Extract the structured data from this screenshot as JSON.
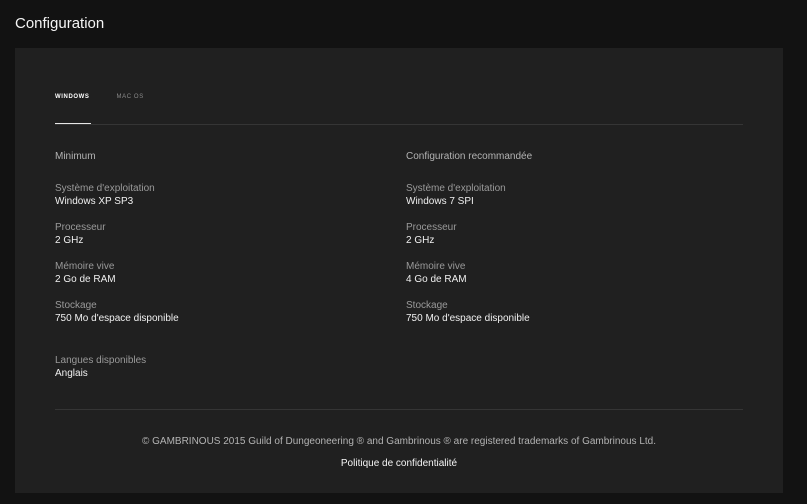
{
  "page": {
    "title": "Configuration"
  },
  "tabs": [
    {
      "label": "WINDOWS",
      "active": true
    },
    {
      "label": "MAC OS",
      "active": false
    }
  ],
  "minimum": {
    "title": "Minimum",
    "specs": [
      {
        "label": "Système d'exploitation",
        "value": "Windows XP SP3"
      },
      {
        "label": "Processeur",
        "value": "2 GHz"
      },
      {
        "label": "Mémoire vive",
        "value": "2 Go de RAM"
      },
      {
        "label": "Stockage",
        "value": "750 Mo d'espace disponible"
      }
    ]
  },
  "recommended": {
    "title": "Configuration recommandée",
    "specs": [
      {
        "label": "Système d'exploitation",
        "value": "Windows 7 SPI"
      },
      {
        "label": "Processeur",
        "value": "2 GHz"
      },
      {
        "label": "Mémoire vive",
        "value": "4 Go de RAM"
      },
      {
        "label": "Stockage",
        "value": "750 Mo d'espace disponible"
      }
    ]
  },
  "languages": {
    "label": "Langues disponibles",
    "value": "Anglais"
  },
  "footer": {
    "copyright": "© GAMBRINOUS 2015 Guild of Dungeoneering ® and Gambrinous ® are registered trademarks of Gambrinous Ltd.",
    "privacy_link": "Politique de confidentialité"
  }
}
